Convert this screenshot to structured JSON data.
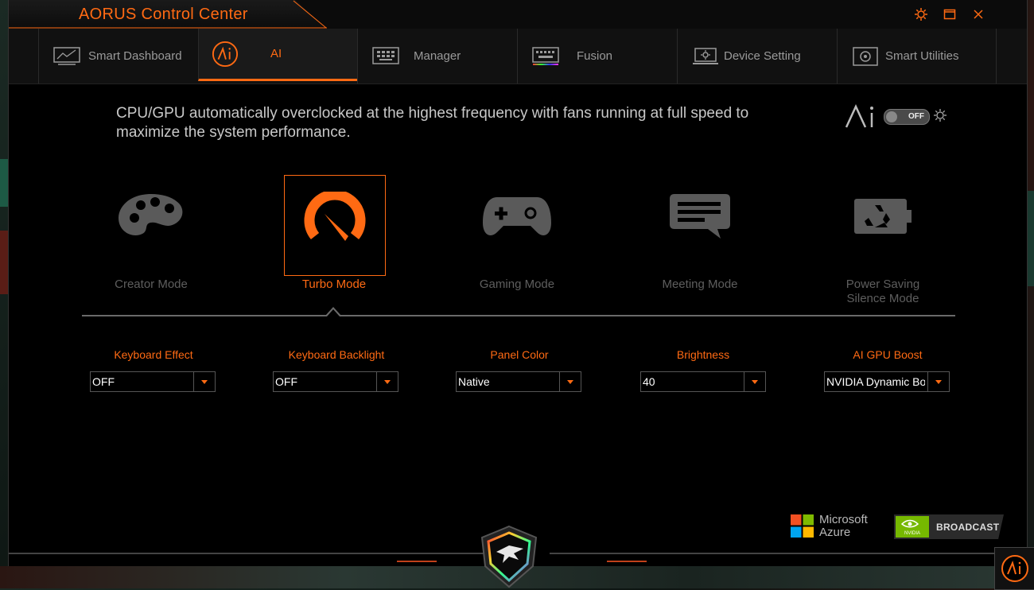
{
  "app": {
    "title": "AORUS Control Center"
  },
  "window_controls": {
    "settings_icon": "gear-icon",
    "maximize_icon": "maximize-icon",
    "close_icon": "close-icon"
  },
  "tabs": [
    {
      "label": "Smart Dashboard",
      "icon": "dashboard-icon",
      "active": false
    },
    {
      "label": "AI",
      "icon": "ai-logo-icon",
      "active": true
    },
    {
      "label": "Manager",
      "icon": "manager-icon",
      "active": false
    },
    {
      "label": "Fusion",
      "icon": "keyboard-icon",
      "active": false
    },
    {
      "label": "Device Setting",
      "icon": "laptop-gear-icon",
      "active": false
    },
    {
      "label": "Smart Utilities",
      "icon": "utilities-icon",
      "active": false
    }
  ],
  "ai_panel": {
    "description": "CPU/GPU automatically overclocked at the highest frequency with fans running at full speed to maximize the system performance.",
    "ai_toggle": {
      "state": "OFF"
    }
  },
  "modes": [
    {
      "label": "Creator Mode",
      "icon": "palette-icon",
      "active": false
    },
    {
      "label": "Turbo Mode",
      "icon": "speedometer-icon",
      "active": true
    },
    {
      "label": "Gaming Mode",
      "icon": "gamepad-icon",
      "active": false
    },
    {
      "label": "Meeting Mode",
      "icon": "chat-icon",
      "active": false
    },
    {
      "label": "Power Saving Silence Mode",
      "icon": "recycle-battery-icon",
      "active": false
    }
  ],
  "settings": [
    {
      "label": "Keyboard Effect",
      "value": "OFF"
    },
    {
      "label": "Keyboard Backlight",
      "value": "OFF"
    },
    {
      "label": "Panel Color",
      "value": "Native"
    },
    {
      "label": "Brightness",
      "value": "40"
    },
    {
      "label": "AI GPU Boost",
      "value": "NVIDIA Dynamic Boost"
    }
  ],
  "partners": {
    "microsoft": {
      "line1": "Microsoft",
      "line2": "Azure"
    },
    "nvidia": {
      "text": "BROADCAST",
      "logo_text": "NVIDIA"
    }
  },
  "colors": {
    "accent": "#ff6a13",
    "background": "#000000",
    "inactive": "#5e5e5e"
  }
}
